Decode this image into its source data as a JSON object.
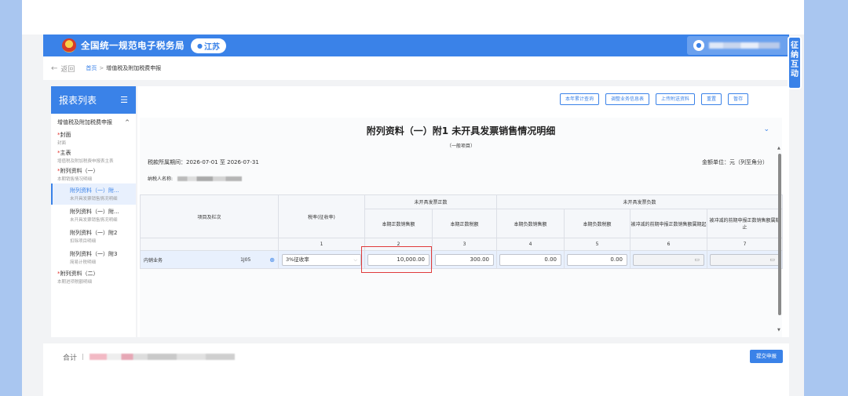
{
  "header": {
    "site_title": "全国统一规范电子税务局",
    "province": "江苏",
    "side_badge": "征纳互动"
  },
  "breadcrumb": {
    "back": "返回",
    "home": "首页",
    "sep": ">",
    "current": "增值税及附加税费申报"
  },
  "sidebar": {
    "title": "报表列表",
    "group": "增值税及附加税费申报",
    "items": [
      {
        "star": "*",
        "title": "封面",
        "sub": "封面"
      },
      {
        "star": "*",
        "title": "主表",
        "sub": "增值税及附加税费申报表主表"
      },
      {
        "star": "*",
        "title": "附列资料（一）",
        "sub": "本期销售情况明细"
      }
    ],
    "subitems": [
      {
        "title": "附列资料（一）附...",
        "sub": "未开具发票销售情况明细"
      },
      {
        "title": "附列资料（一）附...",
        "sub": "未开具发票销售情况明细"
      },
      {
        "title": "附列资料（一）附2",
        "sub": "扣除项目明细"
      },
      {
        "title": "附列资料（一）附3",
        "sub": "简易计税明细"
      }
    ],
    "last": {
      "star": "*",
      "title": "附列资料（二）",
      "sub": "本期进项税额明细"
    }
  },
  "toolbar": {
    "btn1": "本年累计查询",
    "btn2": "调整业务信息表",
    "btn3": "上传附送资料",
    "btn4": "重置",
    "btn5": "暂存"
  },
  "report": {
    "title": "附列资料（一）附1 未开具发票销售情况明细",
    "subtitle": "（一般项目）",
    "period": "税款所属期间：2026-07-01 至 2026-07-31",
    "unit": "金额单位：元（列至角分）",
    "taxpayer_label": "纳税人名称:"
  },
  "table": {
    "col_item": "项目及栏次",
    "col_rate": "税率(征收率)",
    "group_positive": "未开具发票正数",
    "group_negative": "未开具发票负数",
    "sub": [
      "本期正数销售额",
      "本期正数税额",
      "本期负数销售额",
      "本期负数税额",
      "被冲减的前期申报正数销售额属期起",
      "被冲减的前期申报正数销售额属期止"
    ],
    "col_nums": [
      "1",
      "2",
      "3",
      "4",
      "5",
      "6",
      "7"
    ],
    "row": {
      "label": "内销业务",
      "code": "1J05",
      "rate": "3%征收率",
      "v2": "10,000.00",
      "v3": "300.00",
      "v4": "0.00",
      "v5": "0.00"
    }
  },
  "footer": {
    "total_label": "合计",
    "submit": "提交申报"
  }
}
